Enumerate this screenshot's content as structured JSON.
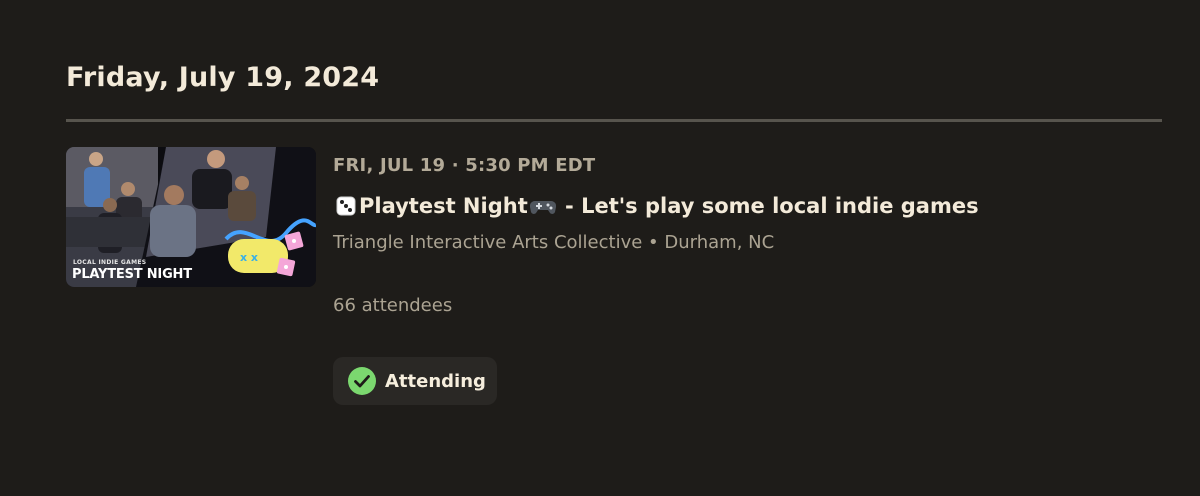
{
  "date_heading": "Friday, July 19, 2024",
  "event": {
    "thumbnail": {
      "kicker": "LOCAL INDIE GAMES",
      "title": "PLAYTEST NIGHT"
    },
    "datetime": "FRI, JUL 19 · 5:30 PM EDT",
    "title_prefix_icon": "die-icon",
    "title_main": "Playtest Night",
    "title_mid_icon": "game-controller-icon",
    "title_suffix": " - Let's play some local indie games",
    "host_location": "Triangle Interactive Arts Collective • Durham, NC",
    "attendees": "66 attendees",
    "rsvp": {
      "label": "Attending",
      "icon": "check-circle-icon",
      "icon_color": "#7bd86f"
    }
  },
  "colors": {
    "background": "#1e1c19",
    "divider": "#57544d",
    "heading": "#f3ead9",
    "muted": "#aba392"
  }
}
